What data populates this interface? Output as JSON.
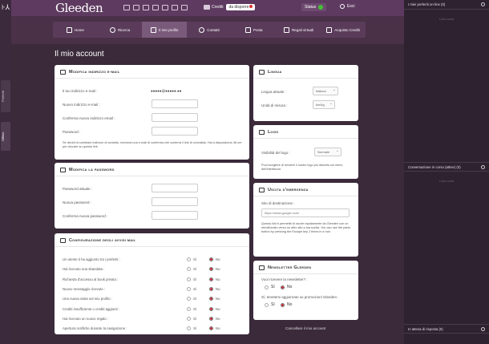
{
  "header": {
    "brand": "Gleeden",
    "credits_label": "Crediti",
    "disconnect_label": "da disporre",
    "status_label": "Status",
    "logout_label": "Esci"
  },
  "left_tabs": [
    "Preferiti",
    "Offline"
  ],
  "nav": {
    "items": [
      {
        "label": "Home",
        "icon": "home-icon"
      },
      {
        "label": "Ricerca",
        "icon": "search-icon"
      },
      {
        "label": "Il mio profilo",
        "icon": "profile-card-icon"
      },
      {
        "label": "Contatti",
        "icon": "contacts-icon"
      },
      {
        "label": "Posta",
        "icon": "mail-icon"
      },
      {
        "label": "Regali virtuali",
        "icon": "gift-icon"
      },
      {
        "label": "Acquisto Crediti",
        "icon": "credit-card-icon"
      }
    ],
    "active_index": 2
  },
  "page_title": "Il mio account",
  "email_panel": {
    "title": "Modifica indirizzo e-mail",
    "current_label": "Il tuo indirizzo e-mail :",
    "current_value": "●●●●●@●●●●●.●●",
    "new_label": "Nuovo indirizzo e-mail :",
    "confirm_label": "Conferma nuovo indirizzo email :",
    "password_label": "Password :",
    "note": "Se decidi di cambiare indirizzo di contatto, riceverai una e-mail di conferma che conterrà il link di convalida. Hai a disposizione 48 ore per cliccare su questo link."
  },
  "password_panel": {
    "title": "Modifica la password",
    "current_label": "Password attuale :",
    "new_label": "Nuova password :",
    "confirm_label": "Conferma nuova password :"
  },
  "notify_panel": {
    "title": "Configurazione degli avvisi mail",
    "yes_label": "Sì",
    "no_label": "No",
    "rows": [
      "Un utente ti ha aggiunto tra i preferiti :",
      "Hai ricevuto una sbandata :",
      "Richiesta d'accesso al book privato :",
      "Nuovo messaggio ricevuto :",
      "Una nuova visita sul mio profilo :",
      "Crediti insufficiente o crediti aggiunti :",
      "Hai ricevuto un nuovo regalo :",
      "Apertura notifiche durante la navigazione :"
    ]
  },
  "language_panel": {
    "title": "Lingua",
    "lang_label": "Lingua attuale :",
    "lang_value": "Italiano",
    "unit_label": "Unità di misura :",
    "unit_value": "km/kg"
  },
  "logo_panel": {
    "title": "Logo",
    "vis_label": "Visibilità del logo :",
    "vis_value": "Normale",
    "note": "Puoi scegliere di rendere il nostro logo più discreto sul menù dell'interfaccia"
  },
  "emergency_panel": {
    "title": "Uscita d'emergenza",
    "site_label": "Sito di destinazione :",
    "site_placeholder": "https://www.google.com/",
    "note": "Questo link ti permette di uscire rapidamente da Gleeden con un reindirizzato verso un altro sito a tua scelta. You can use the panic button by pressing the Escape key 2 times in a row."
  },
  "newsletter_panel": {
    "title": "Newsletter Gleeden",
    "q1": "Vuoi ricevere la newsletter? :",
    "q2": "Sì, tenetemi aggiornato su promozioni Gleeden :",
    "yes_label": "Sì",
    "no_label": "No"
  },
  "delete_link": "Cancellare il mio account",
  "right_sidebar": {
    "favorites_title": "I miei preferiti on-line (0)",
    "favorites_empty": "Lista vuota",
    "conversations_title": "Conversazione in corso (attive) (0)",
    "conversations_empty": "Lista vuota",
    "waiting_title": "In attesa di risposta (0)"
  }
}
